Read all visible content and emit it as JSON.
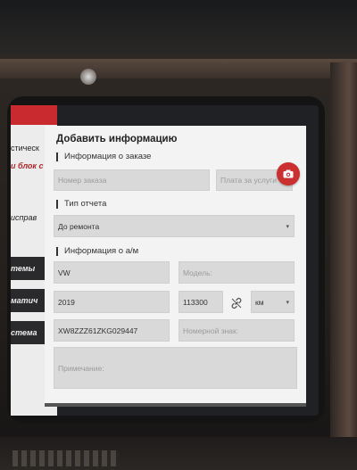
{
  "dialog": {
    "title": "Добавить информацию",
    "order_section": "Информация о заказе",
    "order_number_placeholder": "Номер заказа",
    "service_fee_placeholder": "Плата за услуги",
    "report_section": "Тип отчета",
    "report_type_value": "До ремонта",
    "vehicle_section": "Информация о а/м",
    "make_value": "VW",
    "model_placeholder": "Модель:",
    "year_value": "2019",
    "mileage_value": "113300",
    "unit_value": "км",
    "vin_value": "XW8ZZZ61ZKG029447",
    "plate_placeholder": "Номерной знак:",
    "note_placeholder": "Примечание:"
  },
  "background_app": {
    "rows": [
      "стическ",
      "и блок с",
      "исправ",
      "темы",
      "матич",
      "стема"
    ]
  },
  "colors": {
    "accent_red": "#c9302f",
    "dialog_bg": "#f3f3f3",
    "field_bg": "#d9d9d9"
  },
  "icons": [
    "camera-icon",
    "link-icon",
    "dropdown-caret-icon"
  ]
}
